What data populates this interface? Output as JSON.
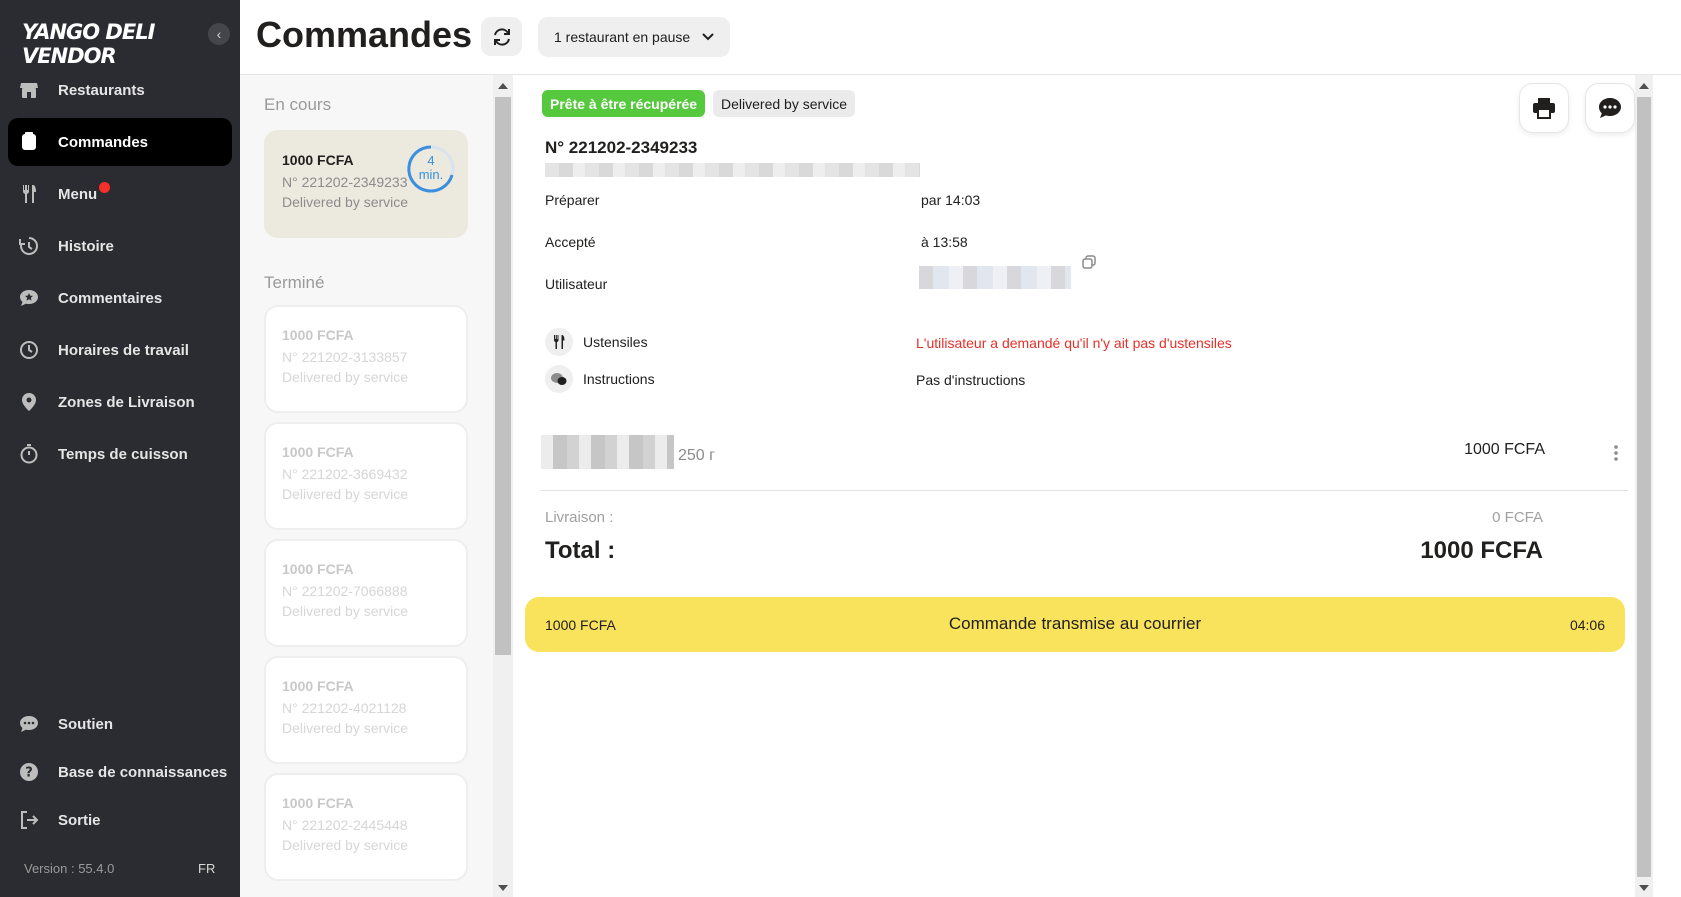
{
  "sidebar": {
    "logo": "YANGO DELI VENDOR",
    "items": [
      {
        "label": "Restaurants",
        "icon": "store-icon"
      },
      {
        "label": "Commandes",
        "icon": "orders-icon",
        "active": true
      },
      {
        "label": "Menu",
        "icon": "fork-knife-icon",
        "badge": "red-dot"
      },
      {
        "label": "Histoire",
        "icon": "history-icon"
      },
      {
        "label": "Commentaires",
        "icon": "comment-star-icon"
      },
      {
        "label": "Horaires de travail",
        "icon": "clock-icon"
      },
      {
        "label": "Zones de Livraison",
        "icon": "location-pin-icon"
      },
      {
        "label": "Temps de cuisson",
        "icon": "stopwatch-icon"
      }
    ],
    "bottom_items": [
      {
        "label": "Soutien",
        "icon": "chat-icon"
      },
      {
        "label": "Base de connaissances",
        "icon": "help-icon"
      },
      {
        "label": "Sortie",
        "icon": "logout-icon"
      }
    ],
    "version": "Version : 55.4.0",
    "lang": "FR"
  },
  "header": {
    "title": "Commandes",
    "pause_select": "1 restaurant en pause"
  },
  "orders": {
    "in_progress_title": "En cours",
    "finished_title": "Terminé",
    "in_progress": [
      {
        "price": "1000 FCFA",
        "number": "N° 221202-2349233",
        "service": "Delivered by service",
        "timer_value": "4",
        "timer_unit": "min."
      }
    ],
    "finished": [
      {
        "price": "1000 FCFA",
        "number": "N° 221202-3133857",
        "service": "Delivered by service"
      },
      {
        "price": "1000 FCFA",
        "number": "N° 221202-3669432",
        "service": "Delivered by service"
      },
      {
        "price": "1000 FCFA",
        "number": "N° 221202-7066888",
        "service": "Delivered by service"
      },
      {
        "price": "1000 FCFA",
        "number": "N° 221202-4021128",
        "service": "Delivered by service"
      },
      {
        "price": "1000 FCFA",
        "number": "N° 221202-2445448",
        "service": "Delivered by service"
      }
    ]
  },
  "detail": {
    "status_badge": "Prête à être récupérée",
    "service_badge": "Delivered by service",
    "order_number": "N° 221202-2349233",
    "rows": {
      "prepare_label": "Préparer",
      "prepare_value": "par 14:03",
      "accepted_label": "Accepté",
      "accepted_value": "à 13:58",
      "user_label": "Utilisateur"
    },
    "utensils_label": "Ustensiles",
    "utensils_value": "L'utilisateur a demandé qu'il n'y ait pas d'ustensiles",
    "instructions_label": "Instructions",
    "instructions_value": "Pas d'instructions",
    "item_weight": "250 г",
    "item_price": "1000 FCFA",
    "delivery_label": "Livraison :",
    "delivery_value": "0 FCFA",
    "total_label": "Total :",
    "total_value": "1000 FCFA",
    "status_bar": {
      "price": "1000 FCFA",
      "text": "Commande transmise au courrier",
      "time": "04:06"
    }
  },
  "colors": {
    "sidebar_bg": "#2b2c31",
    "status_green": "#56c83d",
    "status_yellow": "#fae35c",
    "alert_red": "#e6302a",
    "timer_blue": "#3b8fdd"
  }
}
